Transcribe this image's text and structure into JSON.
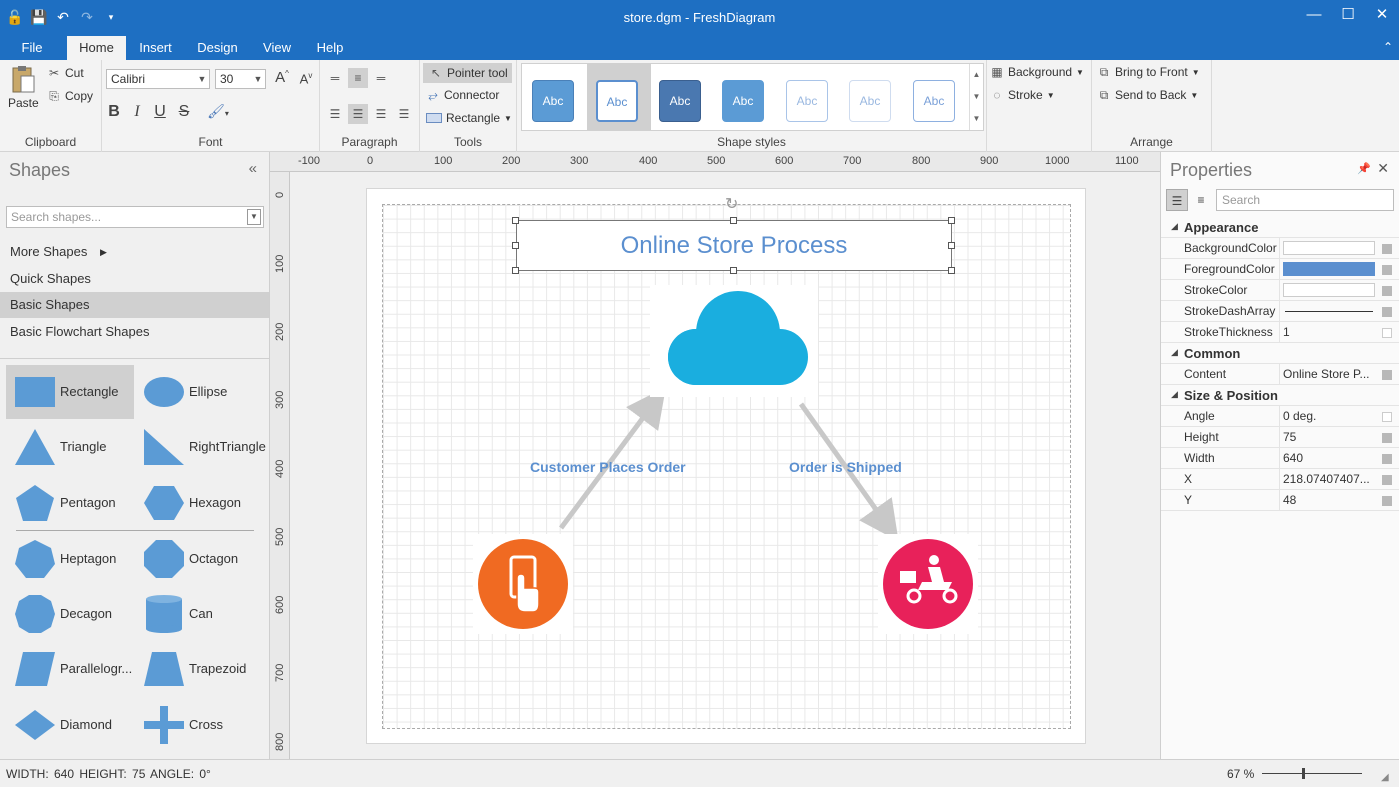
{
  "window": {
    "title": "store.dgm - FreshDiagram",
    "controls": [
      "minimize-icon",
      "maximize-icon",
      "close-icon"
    ]
  },
  "qat": [
    "app-icon",
    "save-icon",
    "undo-icon",
    "redo-icon",
    "qat-customize-icon"
  ],
  "menu": {
    "tabs": [
      "File",
      "Home",
      "Insert",
      "Design",
      "View",
      "Help"
    ],
    "active": "Home"
  },
  "ribbon": {
    "clipboard": {
      "label": "Clipboard",
      "paste": "Paste",
      "cut": "Cut",
      "copy": "Copy"
    },
    "font": {
      "label": "Font",
      "family": "Calibri",
      "size": "30",
      "grow": "A",
      "shrink": "A",
      "bold": "B",
      "italic": "I",
      "underline": "U",
      "strike": "S"
    },
    "paragraph": {
      "label": "Paragraph"
    },
    "tools": {
      "label": "Tools",
      "pointer": "Pointer tool",
      "connector": "Connector",
      "rectangle": "Rectangle"
    },
    "styles": {
      "label": "Shape styles",
      "swatch_text": "Abc"
    },
    "background": {
      "background": "Background",
      "stroke": "Stroke"
    },
    "arrange": {
      "label": "Arrange",
      "front": "Bring to Front",
      "back": "Send to Back"
    }
  },
  "shapes_panel": {
    "title": "Shapes",
    "search_placeholder": "Search shapes...",
    "categories": [
      "More Shapes",
      "Quick Shapes",
      "Basic Shapes",
      "Basic Flowchart Shapes"
    ],
    "selected_category": "Basic Shapes",
    "items": [
      "Rectangle",
      "Ellipse",
      "Triangle",
      "Right Triangle",
      "Pentagon",
      "Hexagon",
      "Heptagon",
      "Octagon",
      "Decagon",
      "Can",
      "Parallelogr...",
      "Trapezoid",
      "Diamond",
      "Cross"
    ],
    "right_triangle_line1": "Right",
    "right_triangle_line2": "Triangle",
    "selected_item": "Rectangle"
  },
  "rulers": {
    "h": [
      "-100",
      "0",
      "100",
      "200",
      "300",
      "400",
      "500",
      "600",
      "700",
      "800",
      "900",
      "1000",
      "1100"
    ],
    "v": [
      "0",
      "100",
      "200",
      "300",
      "400",
      "500",
      "600",
      "700",
      "800"
    ]
  },
  "diagram": {
    "title": "Online Store Process",
    "left_label": "Customer Places Order",
    "right_label": "Order is Shipped",
    "colors": {
      "title": "#5b8fcf",
      "cloud": "#1aaedf",
      "phone_circle": "#f06a22",
      "delivery_circle": "#e8215a",
      "arrow": "#c8c8c8"
    }
  },
  "properties": {
    "title": "Properties",
    "search_placeholder": "Search",
    "appearance": {
      "label": "Appearance",
      "rows": [
        {
          "name": "BackgroundColor",
          "color": "#ffffff"
        },
        {
          "name": "ForegroundColor",
          "color": "#5b8fcf"
        },
        {
          "name": "StrokeColor",
          "color": "#ffffff"
        },
        {
          "name": "StrokeDashArray",
          "value": ""
        },
        {
          "name": "StrokeThickness",
          "value": "1"
        }
      ]
    },
    "common": {
      "label": "Common",
      "content_name": "Content",
      "content_value": "Online Store P..."
    },
    "size_position": {
      "label": "Size & Position",
      "rows": [
        {
          "name": "Angle",
          "value": "0 deg."
        },
        {
          "name": "Height",
          "value": "75"
        },
        {
          "name": "Width",
          "value": "640"
        },
        {
          "name": "X",
          "value": "218.07407407..."
        },
        {
          "name": "Y",
          "value": "48"
        }
      ]
    }
  },
  "status": {
    "text": "WIDTH: 640   HEIGHT: 75   ANGLE: 0°",
    "zoom": "67 %"
  }
}
